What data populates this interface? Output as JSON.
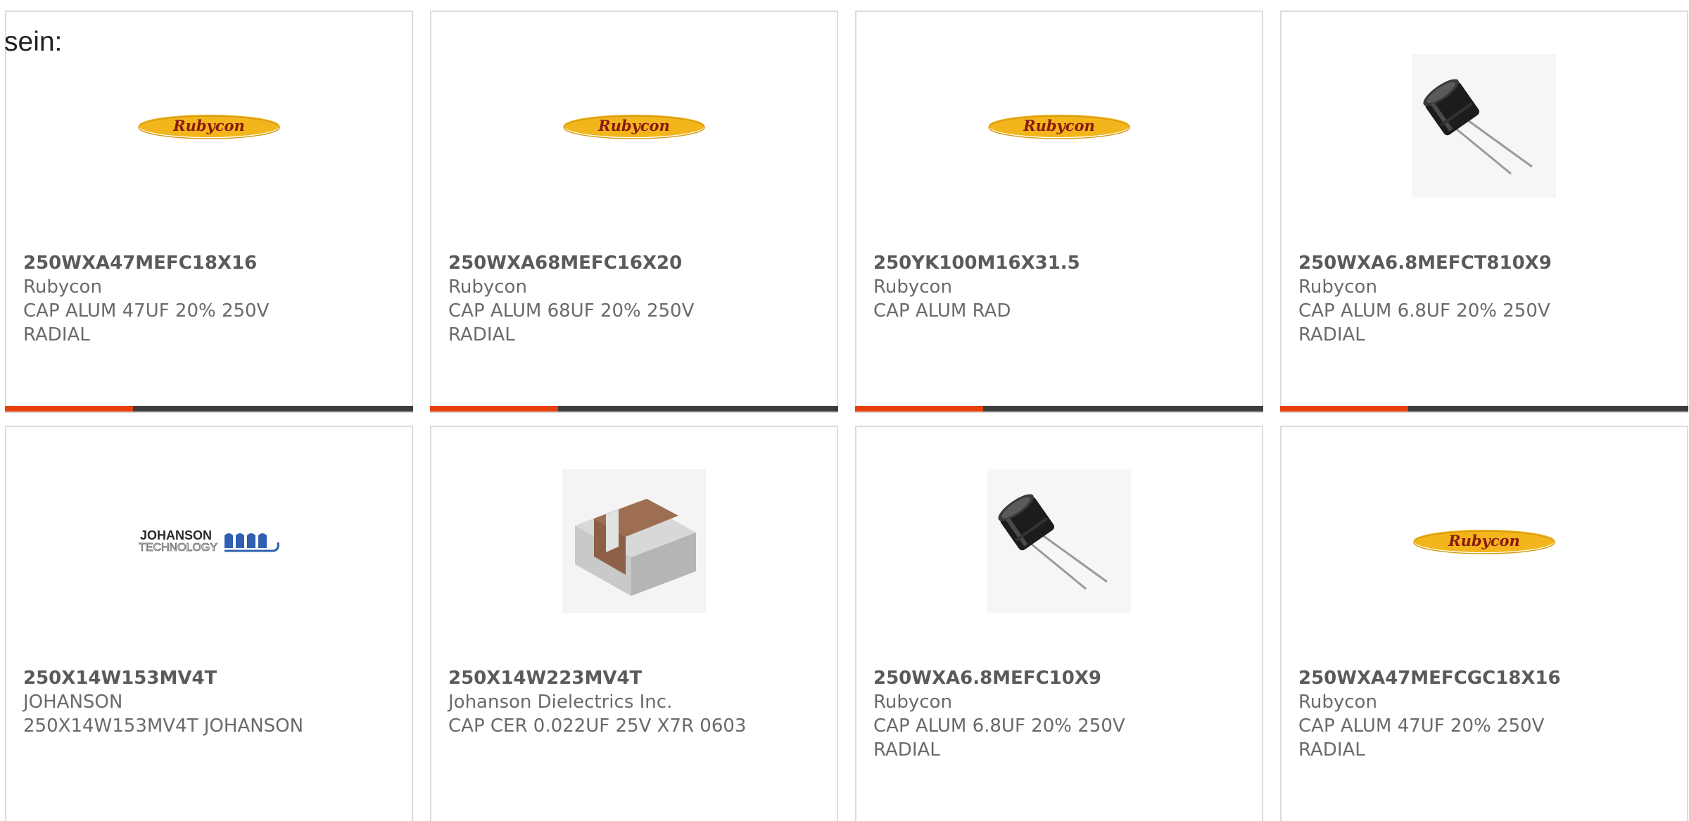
{
  "heading": "sein:",
  "products": [
    {
      "part": "250WXA47MEFC18X16",
      "maker": "Rubycon",
      "desc": [
        "CAP ALUM 47UF 20% 250V",
        "RADIAL"
      ],
      "image": "rubycon-logo",
      "bar": true
    },
    {
      "part": "250WXA68MEFC16X20",
      "maker": "Rubycon",
      "desc": [
        "CAP ALUM 68UF 20% 250V",
        "RADIAL"
      ],
      "image": "rubycon-logo",
      "bar": true
    },
    {
      "part": "250YK100M16X31.5",
      "maker": "Rubycon",
      "desc": [
        "CAP ALUM RAD"
      ],
      "image": "rubycon-logo",
      "bar": true
    },
    {
      "part": "250WXA6.8MEFCT810X9",
      "maker": "Rubycon",
      "desc": [
        "CAP ALUM 6.8UF 20% 250V",
        "RADIAL"
      ],
      "image": "electrolytic-capacitor-photo",
      "bar": true
    },
    {
      "part": "250X14W153MV4T",
      "maker": "JOHANSON",
      "desc": [
        "250X14W153MV4T JOHANSON"
      ],
      "image": "johanson-technology-logo",
      "bar": false
    },
    {
      "part": "250X14W223MV4T",
      "maker": "Johanson Dielectrics Inc.",
      "desc": [
        "CAP CER 0.022UF 25V X7R 0603"
      ],
      "image": "smd-ceramic-capacitor-photo",
      "bar": false
    },
    {
      "part": "250WXA6.8MEFC10X9",
      "maker": "Rubycon",
      "desc": [
        "CAP ALUM 6.8UF 20% 250V",
        "RADIAL"
      ],
      "image": "electrolytic-capacitor-photo",
      "bar": false
    },
    {
      "part": "250WXA47MEFCGC18X16",
      "maker": "Rubycon",
      "desc": [
        "CAP ALUM 47UF 20% 250V",
        "RADIAL"
      ],
      "image": "rubycon-logo",
      "bar": false
    }
  ],
  "logos": {
    "rubycon": "Rubycon",
    "johanson_top": "JOHANSON",
    "johanson_bottom": "TECHNOLOGY"
  },
  "colors": {
    "accent": "#e8400c",
    "bar": "#3d3d3d",
    "rubycon_yellow": "#f2b51c",
    "rubycon_text": "#8a1a10"
  }
}
